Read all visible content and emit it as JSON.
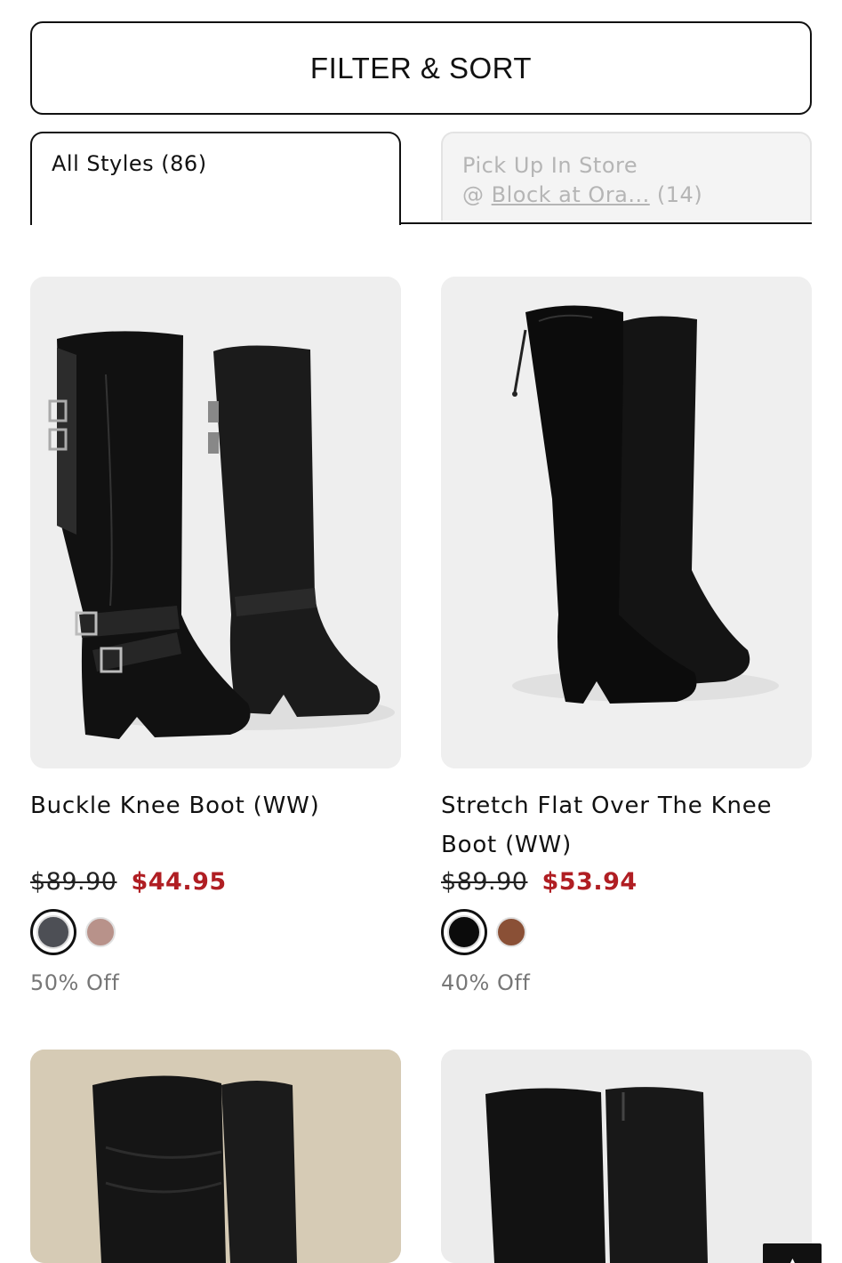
{
  "filter": {
    "label": "FILTER & SORT"
  },
  "tabs": {
    "all": {
      "label": "All Styles (86)"
    },
    "store": {
      "line1": "Pick Up In Store",
      "prefix": "@ ",
      "store_name": "Block at Ora...",
      "count": " (14)"
    }
  },
  "products": [
    {
      "title": "Buckle Knee Boot (WW)",
      "original_price": "$89.90",
      "sale_price": "$44.95",
      "discount": "50% Off",
      "swatches": [
        "#4d4f55",
        "#b8928a"
      ]
    },
    {
      "title": "Stretch Flat Over The Knee Boot (WW)",
      "original_price": "$89.90",
      "sale_price": "$53.94",
      "discount": "40% Off",
      "swatches": [
        "#0b0b0b",
        "#8a5036"
      ]
    }
  ],
  "colors": {
    "sale": "#b01e23",
    "text": "#111111",
    "muted": "#777777"
  },
  "icons": {
    "corner": "chevron-up-icon"
  }
}
